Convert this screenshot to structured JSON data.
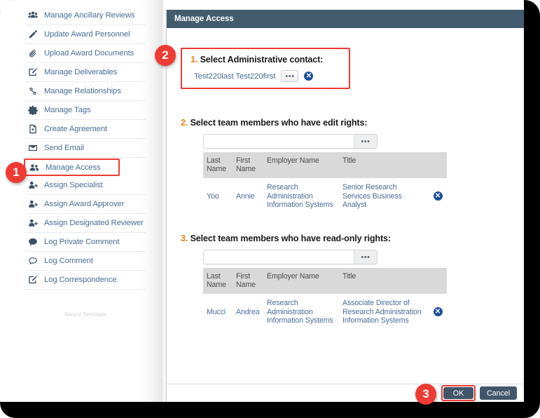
{
  "sidebar": {
    "items": [
      {
        "label": "Manage Ancillary Reviews",
        "icon": "users-group-icon",
        "selected": false
      },
      {
        "label": "Update Award Personnel",
        "icon": "pencil-icon",
        "selected": false
      },
      {
        "label": "Upload Award Documents",
        "icon": "paperclip-icon",
        "selected": false
      },
      {
        "label": "Manage Deliverables",
        "icon": "edit-square-icon",
        "selected": false
      },
      {
        "label": "Manage Relationships",
        "icon": "link-chain-icon",
        "selected": false
      },
      {
        "label": "Manage Tags",
        "icon": "gear-icon",
        "selected": false
      },
      {
        "label": "Create Agreement",
        "icon": "document-star-icon",
        "selected": false
      },
      {
        "label": "Send Email",
        "icon": "envelope-icon",
        "selected": false
      },
      {
        "label": "Manage Access",
        "icon": "users-two-icon",
        "selected": true
      },
      {
        "label": "Assign Specialist",
        "icon": "user-plus-icon",
        "selected": false
      },
      {
        "label": "Assign Award Approver",
        "icon": "user-plus-icon",
        "selected": false
      },
      {
        "label": "Assign Designated Reviewer",
        "icon": "user-plus-icon",
        "selected": false
      },
      {
        "label": "Log Private Comment",
        "icon": "speech-filled-icon",
        "selected": false
      },
      {
        "label": "Log Comment",
        "icon": "speech-outline-icon",
        "selected": false
      },
      {
        "label": "Log Correspondence",
        "icon": "edit-square-icon",
        "selected": false
      }
    ],
    "footer_label": "Award Template"
  },
  "dialog": {
    "title": "Manage Access",
    "section1": {
      "number": "1.",
      "heading": "Select Administrative contact:",
      "contact_name": "Test220last Test220first",
      "browse_icon": "ellipsis-icon",
      "remove_icon": "remove-circle-icon"
    },
    "section2": {
      "number": "2.",
      "heading": "Select team members who have edit rights:",
      "search_value": "",
      "search_placeholder": "",
      "picker_icon": "ellipsis-icon",
      "columns": [
        "Last Name",
        "First Name",
        "Employer Name",
        "Title",
        ""
      ],
      "rows": [
        {
          "last_name": "Yoo",
          "first_name": "Annie",
          "employer_name": "Research Administration Information Systems",
          "title": "Senior Research Services Business Analyst",
          "remove_icon": "remove-circle-icon"
        }
      ]
    },
    "section3": {
      "number": "3.",
      "heading": "Select team members who have read-only rights:",
      "search_value": "",
      "search_placeholder": "",
      "picker_icon": "ellipsis-icon",
      "columns": [
        "Last Name",
        "First Name",
        "Employer Name",
        "Title",
        ""
      ],
      "rows": [
        {
          "last_name": "Mucci",
          "first_name": "Andrea",
          "employer_name": "Research Administration Information Systems",
          "title": "Associate Director of Research Administration Information Systems",
          "remove_icon": "remove-circle-icon"
        }
      ]
    },
    "footer": {
      "ok_label": "OK",
      "cancel_label": "Cancel"
    }
  },
  "callouts": {
    "one": "1",
    "two": "2",
    "three": "3"
  },
  "colors": {
    "accent_red": "#ee3b33",
    "titlebar": "#425c6e",
    "link_blue": "#4a6c94",
    "number_orange": "#e8820c",
    "header_gray": "#d9d9d9",
    "remove_blue": "#1f4e9c"
  }
}
